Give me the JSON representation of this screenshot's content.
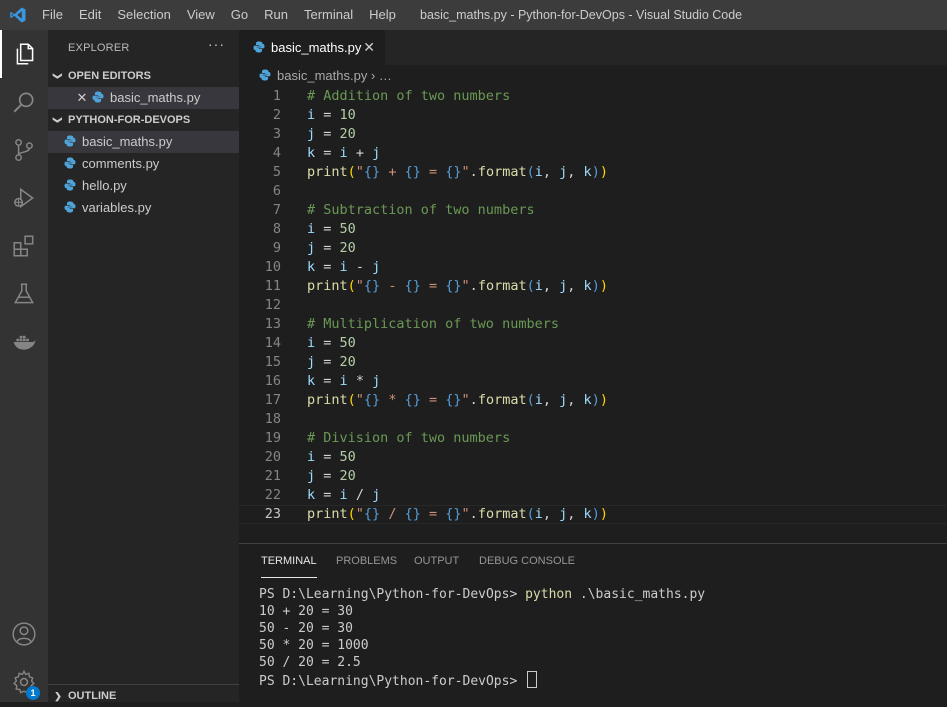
{
  "titlebar": {
    "menu": [
      "File",
      "Edit",
      "Selection",
      "View",
      "Go",
      "Run",
      "Terminal",
      "Help"
    ],
    "window_title": "basic_maths.py - Python-for-DevOps - Visual Studio Code"
  },
  "activity_bar": {
    "icons": [
      "explorer-icon",
      "search-icon",
      "source-control-icon",
      "run-debug-icon",
      "extensions-icon",
      "testing-icon",
      "docker-icon",
      "account-icon",
      "settings-gear-icon"
    ],
    "settings_badge": "1"
  },
  "sidebar": {
    "title": "EXPLORER",
    "more": "···",
    "open_editors_label": "OPEN EDITORS",
    "open_editors": [
      {
        "label": "basic_maths.py"
      }
    ],
    "folder_label": "PYTHON-FOR-DEVOPS",
    "files": [
      {
        "label": "basic_maths.py"
      },
      {
        "label": "comments.py"
      },
      {
        "label": "hello.py"
      },
      {
        "label": "variables.py"
      }
    ],
    "outline_label": "OUTLINE"
  },
  "editor": {
    "tab_label": "basic_maths.py",
    "breadcrumb_file": "basic_maths.py",
    "breadcrumb_more": "…",
    "line_numbers": [
      "1",
      "2",
      "3",
      "4",
      "5",
      "6",
      "7",
      "8",
      "9",
      "10",
      "11",
      "12",
      "13",
      "14",
      "15",
      "16",
      "17",
      "18",
      "19",
      "20",
      "21",
      "22",
      "23"
    ],
    "current_line": 23,
    "comments": [
      "# Addition of two numbers",
      "# Subtraction of two numbers",
      "# Multiplication of two numbers",
      "# Division of two numbers"
    ],
    "operators": [
      "+",
      "-",
      "*",
      "/"
    ],
    "values": {
      "i1": "10",
      "j1": "20",
      "i": "50",
      "j": "20"
    }
  },
  "panel": {
    "tabs": [
      "TERMINAL",
      "PROBLEMS",
      "OUTPUT",
      "DEBUG CONSOLE"
    ],
    "prompt": "PS D:\\Learning\\Python-for-DevOps>",
    "command": "python",
    "command_args": ".\\basic_maths.py",
    "output": [
      "10 + 20 = 30",
      "50 - 20 = 30",
      "50 * 20 = 1000",
      "50 / 20 = 2.5"
    ]
  },
  "colors": {
    "accent": "#007acc",
    "comment": "#6a9955",
    "variable": "#9cdcfe",
    "number": "#b5cea8",
    "function": "#dcdcaa",
    "string": "#ce9178"
  }
}
